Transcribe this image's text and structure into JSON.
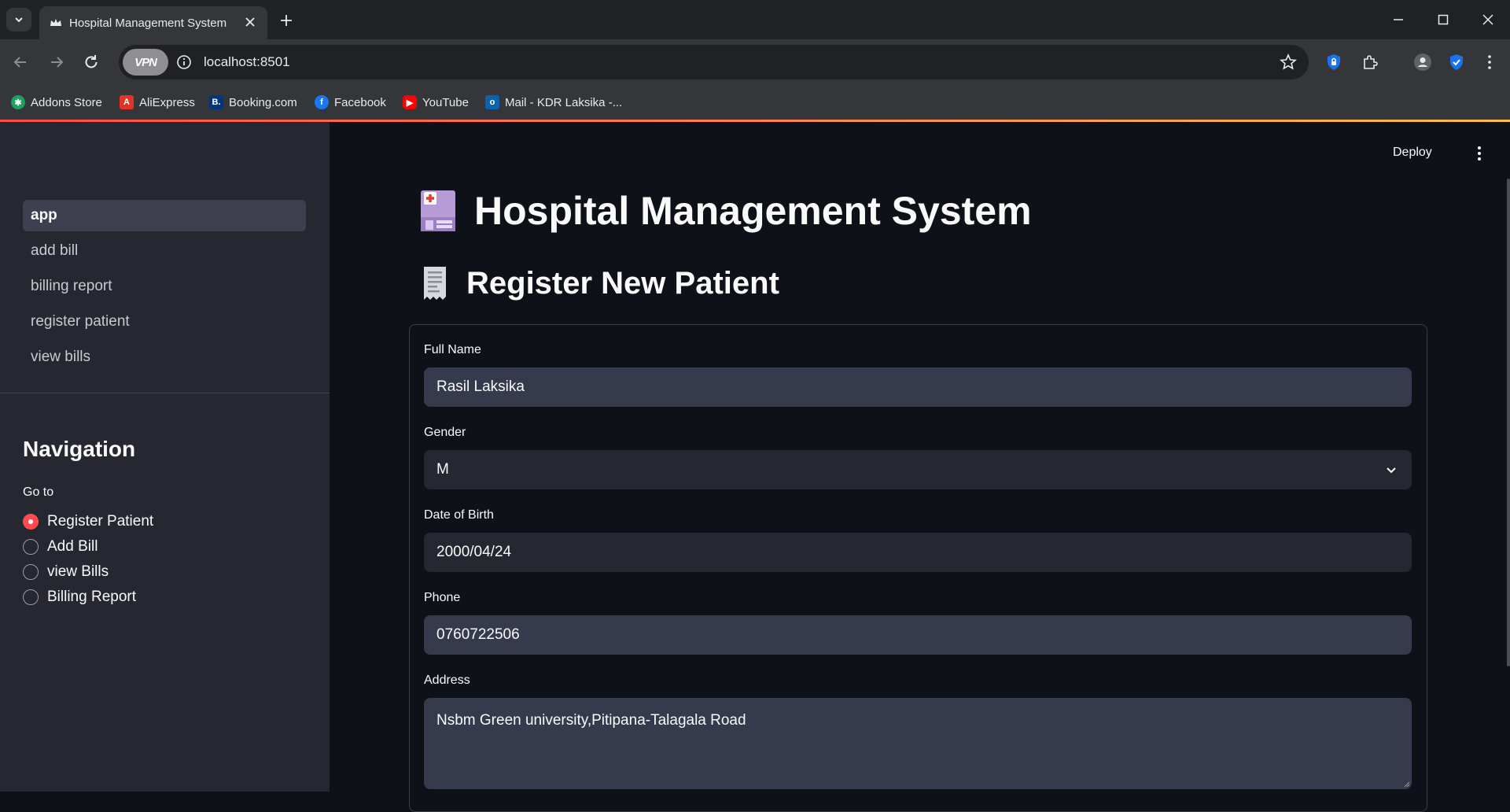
{
  "browser": {
    "tab_title": "Hospital Management System",
    "url": "localhost:8501",
    "vpn_label": "VPN",
    "bookmarks": [
      {
        "label": "Addons Store",
        "icon": "puzzle-addons-icon",
        "color": "#1aa260"
      },
      {
        "label": "AliExpress",
        "icon": "aliexpress-icon",
        "color": "#e43225"
      },
      {
        "label": "Booking.com",
        "icon": "booking-icon",
        "color": "#003580"
      },
      {
        "label": "Facebook",
        "icon": "facebook-icon",
        "color": "#1877f2"
      },
      {
        "label": "YouTube",
        "icon": "youtube-icon",
        "color": "#ff0000"
      },
      {
        "label": "Mail - KDR Laksika -...",
        "icon": "outlook-icon",
        "color": "#0a64ad"
      }
    ]
  },
  "sidebar": {
    "pages": [
      {
        "label": "app",
        "active": true
      },
      {
        "label": "add bill",
        "active": false
      },
      {
        "label": "billing report",
        "active": false
      },
      {
        "label": "register patient",
        "active": false
      },
      {
        "label": "view bills",
        "active": false
      }
    ],
    "nav_heading": "Navigation",
    "goto_label": "Go to",
    "options": [
      {
        "label": "Register Patient",
        "checked": true
      },
      {
        "label": "Add Bill",
        "checked": false
      },
      {
        "label": "view Bills",
        "checked": false
      },
      {
        "label": "Billing Report",
        "checked": false
      }
    ]
  },
  "main": {
    "deploy_label": "Deploy",
    "title": "Hospital Management System",
    "title_icon": "hospital-icon",
    "subtitle": "Register New Patient",
    "subtitle_icon": "receipt-icon",
    "form": {
      "full_name_label": "Full Name",
      "full_name_value": "Rasil Laksika",
      "gender_label": "Gender",
      "gender_value": "M",
      "dob_label": "Date of Birth",
      "dob_value": "2000/04/24",
      "phone_label": "Phone",
      "phone_value": "0760722506",
      "address_label": "Address",
      "address_value": "Nsbm Green university,Pitipana-Talagala Road"
    }
  },
  "colors": {
    "accent": "#ff4b4b",
    "sidebar_bg": "#262730",
    "main_bg": "#0e1117",
    "input_bg": "#353b4d"
  }
}
